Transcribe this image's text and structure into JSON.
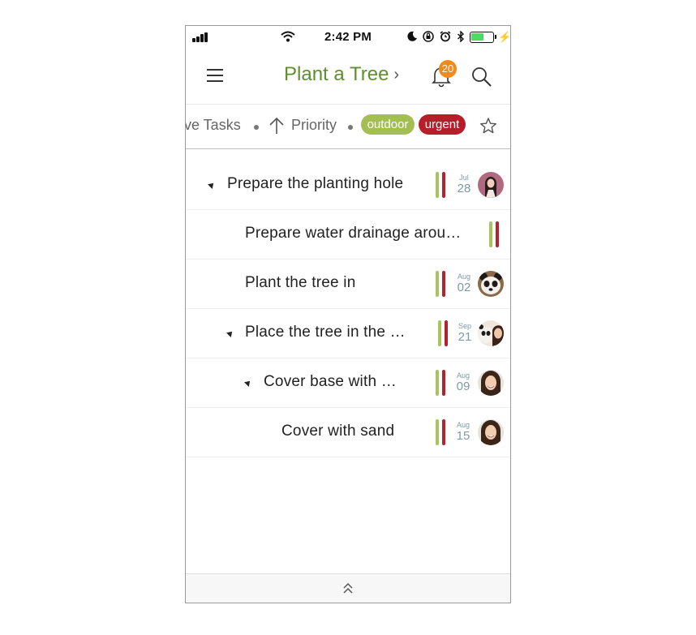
{
  "status_bar": {
    "time": "2:42 PM"
  },
  "header": {
    "title": "Plant a Tree",
    "chevron": "›",
    "notification_count": "20"
  },
  "filters": {
    "view_text": "ve Tasks",
    "sort_text": "Priority",
    "tags": [
      {
        "label": "outdoor",
        "color": "#a3bf54"
      },
      {
        "label": "urgent",
        "color": "#b71e29"
      }
    ]
  },
  "tasks": [
    {
      "title": "Prepare the planting hole",
      "month": "Jul",
      "day": "28",
      "avatar": "woman-with-dark-hair"
    },
    {
      "title": "Prepare water drainage arou…",
      "month": "",
      "day": "",
      "avatar": ""
    },
    {
      "title": "Plant the tree in",
      "month": "Aug",
      "day": "02",
      "avatar": "panda"
    },
    {
      "title": "Place the tree in the …",
      "month": "Sep",
      "day": "21",
      "avatar": "panda-and-woman"
    },
    {
      "title": "Cover base with …",
      "month": "Aug",
      "day": "09",
      "avatar": "smiling-woman"
    },
    {
      "title": "Cover with sand",
      "month": "Aug",
      "day": "15",
      "avatar": "smiling-woman"
    }
  ],
  "colors": {
    "accent_green": "#5e8f2c",
    "priority_green": "#a7c55a",
    "priority_red": "#b2232d",
    "badge_orange": "#f08a1a",
    "date_gray": "#7d9aa3"
  }
}
